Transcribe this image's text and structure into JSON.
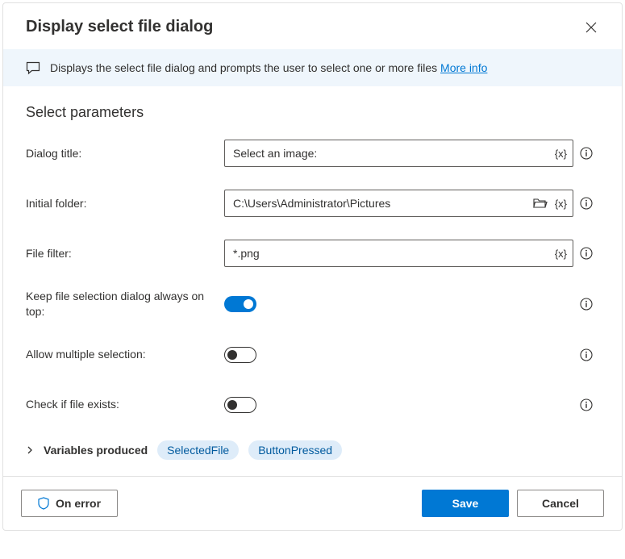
{
  "title": "Display select file dialog",
  "banner": {
    "text": "Displays the select file dialog and prompts the user to select one or more files ",
    "link": "More info"
  },
  "section": "Select parameters",
  "fields": {
    "dialog_title": {
      "label": "Dialog title:",
      "value": "Select an image:"
    },
    "initial_folder": {
      "label": "Initial folder:",
      "value": "C:\\Users\\Administrator\\Pictures"
    },
    "file_filter": {
      "label": "File filter:",
      "value": "*.png"
    },
    "always_on_top": {
      "label": "Keep file selection dialog always on top:"
    },
    "multi_select": {
      "label": "Allow multiple selection:"
    },
    "check_exists": {
      "label": "Check if file exists:"
    }
  },
  "variables": {
    "label": "Variables produced",
    "chips": [
      "SelectedFile",
      "ButtonPressed"
    ]
  },
  "footer": {
    "on_error": "On error",
    "save": "Save",
    "cancel": "Cancel"
  }
}
